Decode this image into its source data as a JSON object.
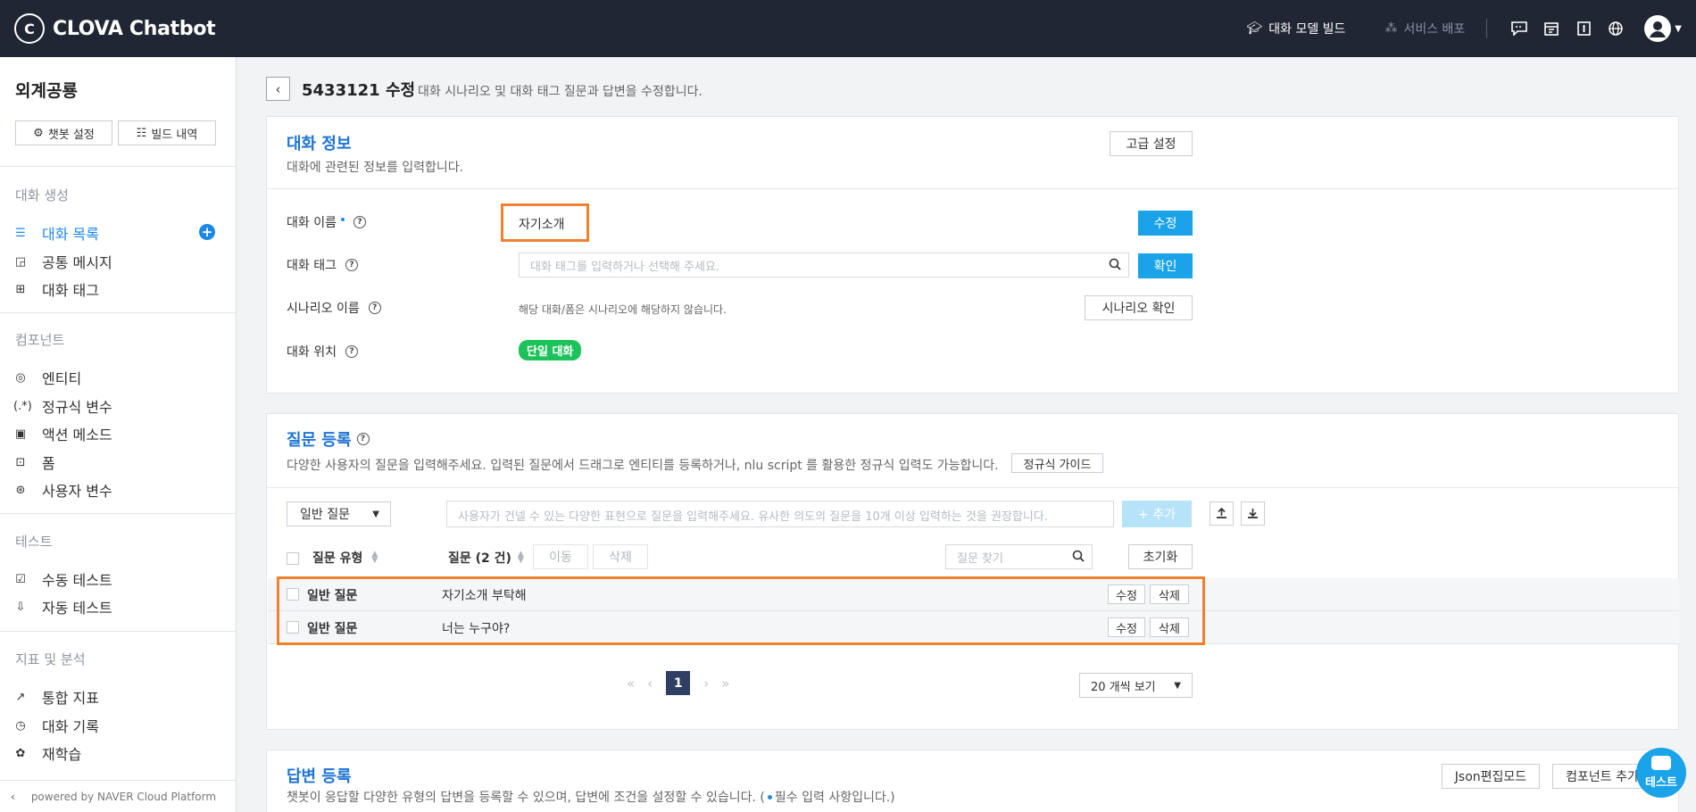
{
  "topbar": {
    "logo_mark": "C",
    "logo_text": "CLOVA Chatbot",
    "build_label": "대화 모델 빌드",
    "deploy_label": "서비스 배포",
    "icons": [
      "chat-icon",
      "calendar-icon",
      "book-icon",
      "globe-icon"
    ]
  },
  "sidebar": {
    "title": "외계공룡",
    "settings_btn": "챗봇 설정",
    "history_btn": "빌드 내역",
    "sections": {
      "create": "대화 생성",
      "component": "컴포넌트",
      "test": "테스트",
      "analytics": "지표 및 분석"
    },
    "items": {
      "conversation_list": "대화 목록",
      "common_message": "공통 메시지",
      "conversation_tag": "대화 태그",
      "entity": "엔티티",
      "regex_var": "정규식 변수",
      "action_method": "액션 메소드",
      "form": "폼",
      "user_var": "사용자 변수",
      "manual_test": "수동 테스트",
      "auto_test": "자동 테스트",
      "stats": "통합 지표",
      "log": "대화 기록",
      "retrain": "재학습"
    },
    "add_symbol": "+",
    "footer": "powered by NAVER Cloud Platform"
  },
  "page": {
    "title": "5433121 수정",
    "description": "대화 시나리오 및 대화 태그 질문과 답변을 수정합니다."
  },
  "info": {
    "title": "대화 정보",
    "subtitle": "대화에 관련된 정보를 입력합니다.",
    "advanced_btn": "고급 설정",
    "name_label": "대화 이름",
    "name_value": "자기소개",
    "edit_btn": "수정",
    "tag_label": "대화 태그",
    "tag_placeholder": "대화 태그를 입력하거나 선택해 주세요.",
    "confirm_btn": "확인",
    "scenario_label": "시나리오 이름",
    "scenario_value": "해당 대화/폼은 시나리오에 해당하지 않습니다.",
    "scenario_btn": "시나리오 확인",
    "position_label": "대화 위치",
    "position_badge": "단일 대화"
  },
  "questions": {
    "title": "질문 등록",
    "subtitle": "다양한 사용자의 질문을 입력해주세요. 입력된 질문에서 드래그로 엔티티를 등록하거나, nlu script 를 활용한 정규식 입력도 가능합니다.",
    "guide_btn": "정규식 가이드",
    "type_select": "일반 질문",
    "input_placeholder": "사용자가 건넬 수 있는 다양한 표현으로 질문을 입력해주세요. 유사한 의도의 질문을 10개 이상 입력하는 것을 권장합니다.",
    "add_btn": "+ 추가",
    "col_type": "질문 유형",
    "col_question": "질문 (2 건)",
    "move_btn": "이동",
    "delete_btn": "삭제",
    "search_placeholder": "질문 찾기",
    "reset_btn": "초기화",
    "rows": [
      {
        "type": "일반 질문",
        "text": "자기소개 부탁해",
        "edit": "수정",
        "delete": "삭제"
      },
      {
        "type": "일반 질문",
        "text": "너는 누구야?",
        "edit": "수정",
        "delete": "삭제"
      }
    ],
    "current_page": "1",
    "page_size": "20 개씩 보기"
  },
  "answers": {
    "title": "답변 등록",
    "subtitle": "챗봇이 응답할 다양한 유형의 답변을 등록할 수 있으며, 답변에 조건을 설정할 수 있습니다. (",
    "subtitle_end": "필수 입력 사항입니다.)",
    "json_btn": "Json편집모드",
    "component_btn": "컴포넌트 추가"
  },
  "floating": {
    "test_label": "테스트"
  },
  "colors": {
    "topbar": "#202633",
    "accent_blue": "#1e74d2",
    "button_blue": "#1aa3e8",
    "highlight_orange": "#f0812f",
    "badge_green": "#1ec25b"
  }
}
